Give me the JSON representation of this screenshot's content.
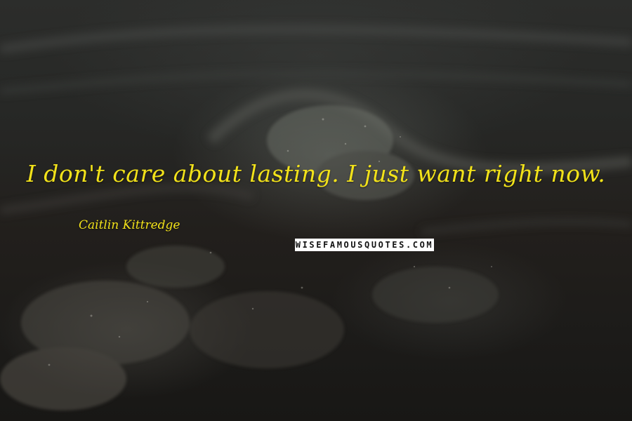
{
  "quote": {
    "text": "I don't care about lasting. I just want right now.",
    "author": "Caitlin Kittredge"
  },
  "watermark": {
    "text": "WISEFAMOUSQUOTES.COM"
  },
  "colors": {
    "text_accent": "#f2e21a",
    "background_dark": "#1f201e",
    "watermark_bg": "#ffffff"
  }
}
